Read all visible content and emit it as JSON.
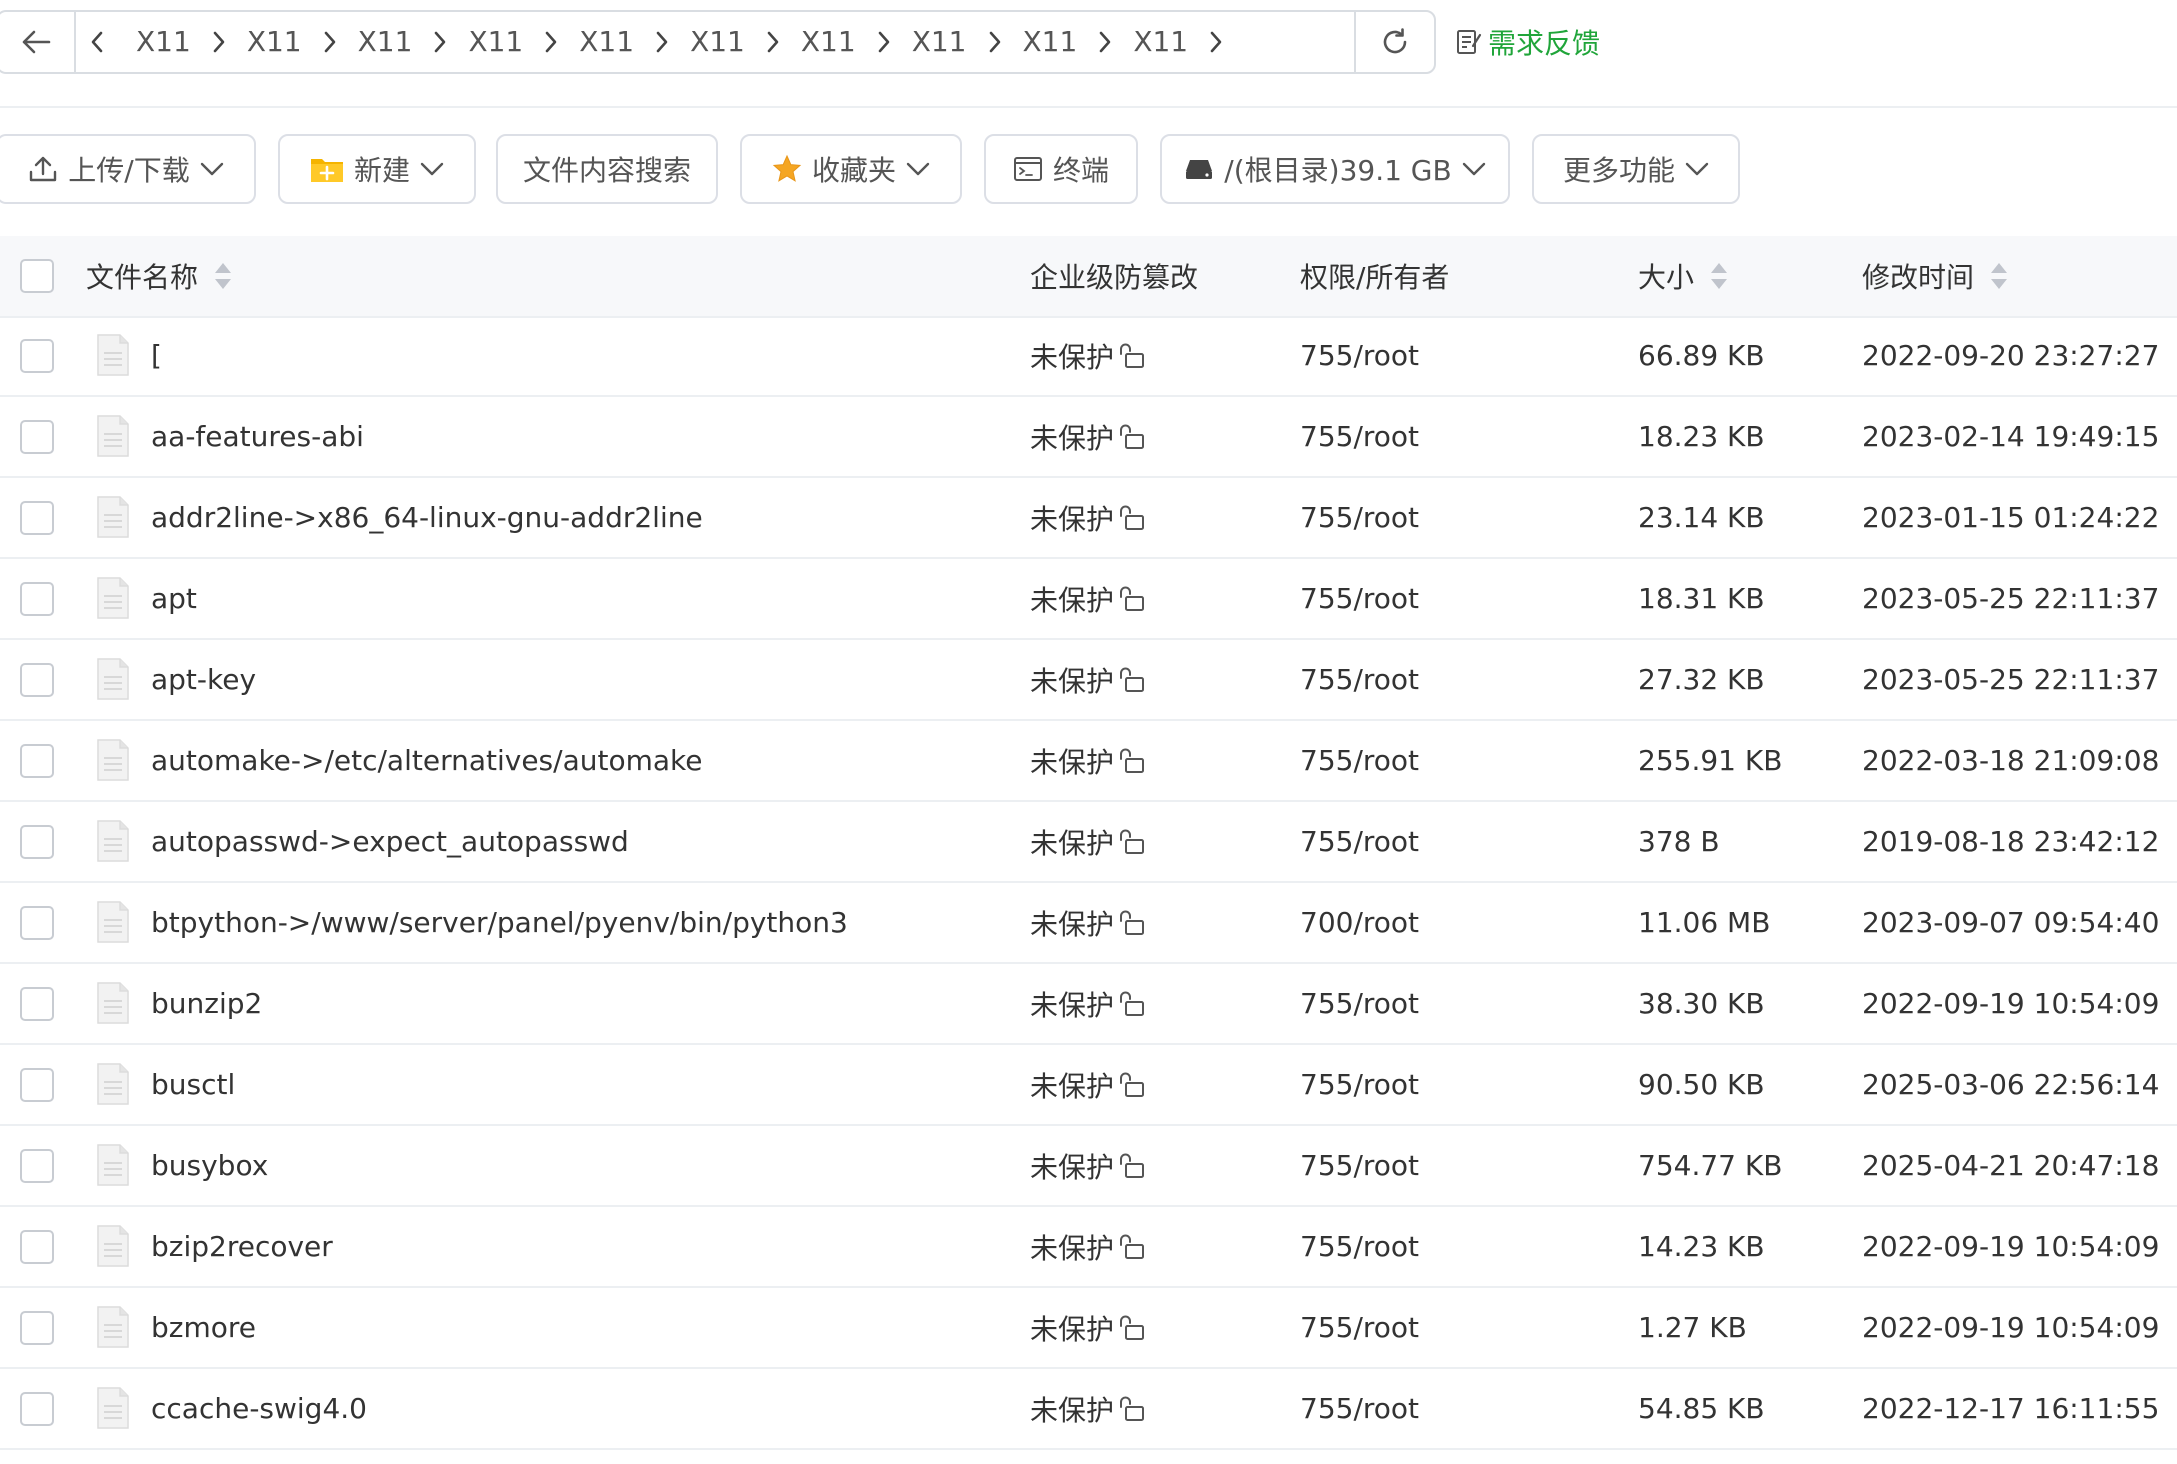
{
  "path_bar": {
    "crumbs": [
      "X11",
      "X11",
      "X11",
      "X11",
      "X11",
      "X11",
      "X11",
      "X11",
      "X11",
      "X11"
    ],
    "feedback_label": "需求反馈"
  },
  "toolbar": {
    "upload_label": "上传/下载",
    "new_label": "新建",
    "search_content_label": "文件内容搜索",
    "favorites_label": "收藏夹",
    "terminal_label": "终端",
    "disk_label": "/(根目录)39.1 GB",
    "more_label": "更多功能"
  },
  "table": {
    "headers": {
      "name": "文件名称",
      "protect": "企业级防篡改",
      "perm": "权限/所有者",
      "size": "大小",
      "mtime": "修改时间"
    },
    "rows": [
      {
        "name": "[",
        "protect": "未保护",
        "perm": "755/root",
        "size": "66.89 KB",
        "mtime": "2022-09-20 23:27:27"
      },
      {
        "name": "aa-features-abi",
        "protect": "未保护",
        "perm": "755/root",
        "size": "18.23 KB",
        "mtime": "2023-02-14 19:49:15"
      },
      {
        "name": "addr2line->x86_64-linux-gnu-addr2line",
        "protect": "未保护",
        "perm": "755/root",
        "size": "23.14 KB",
        "mtime": "2023-01-15 01:24:22"
      },
      {
        "name": "apt",
        "protect": "未保护",
        "perm": "755/root",
        "size": "18.31 KB",
        "mtime": "2023-05-25 22:11:37"
      },
      {
        "name": "apt-key",
        "protect": "未保护",
        "perm": "755/root",
        "size": "27.32 KB",
        "mtime": "2023-05-25 22:11:37"
      },
      {
        "name": "automake->/etc/alternatives/automake",
        "protect": "未保护",
        "perm": "755/root",
        "size": "255.91 KB",
        "mtime": "2022-03-18 21:09:08"
      },
      {
        "name": "autopasswd->expect_autopasswd",
        "protect": "未保护",
        "perm": "755/root",
        "size": "378 B",
        "mtime": "2019-08-18 23:42:12"
      },
      {
        "name": "btpython->/www/server/panel/pyenv/bin/python3",
        "protect": "未保护",
        "perm": "700/root",
        "size": "11.06 MB",
        "mtime": "2023-09-07 09:54:40"
      },
      {
        "name": "bunzip2",
        "protect": "未保护",
        "perm": "755/root",
        "size": "38.30 KB",
        "mtime": "2022-09-19 10:54:09"
      },
      {
        "name": "busctl",
        "protect": "未保护",
        "perm": "755/root",
        "size": "90.50 KB",
        "mtime": "2025-03-06 22:56:14"
      },
      {
        "name": "busybox",
        "protect": "未保护",
        "perm": "755/root",
        "size": "754.77 KB",
        "mtime": "2025-04-21 20:47:18"
      },
      {
        "name": "bzip2recover",
        "protect": "未保护",
        "perm": "755/root",
        "size": "14.23 KB",
        "mtime": "2022-09-19 10:54:09"
      },
      {
        "name": "bzmore",
        "protect": "未保护",
        "perm": "755/root",
        "size": "1.27 KB",
        "mtime": "2022-09-19 10:54:09"
      },
      {
        "name": "ccache-swig4.0",
        "protect": "未保护",
        "perm": "755/root",
        "size": "54.85 KB",
        "mtime": "2022-12-17 16:11:55"
      }
    ]
  },
  "colors": {
    "accent_green": "#20a53a",
    "border": "#dcdfe6",
    "header_bg": "#f7f8fa",
    "folder_yellow": "#f5b400"
  },
  "icons": [
    "arrow-left-icon",
    "chevron-left-icon",
    "chevron-right-icon",
    "refresh-icon",
    "feedback-icon",
    "upload-icon",
    "folder-plus-icon",
    "star-icon",
    "terminal-icon",
    "disk-icon",
    "chevron-down-icon",
    "sort-icon",
    "file-icon",
    "lock-open-icon"
  ]
}
